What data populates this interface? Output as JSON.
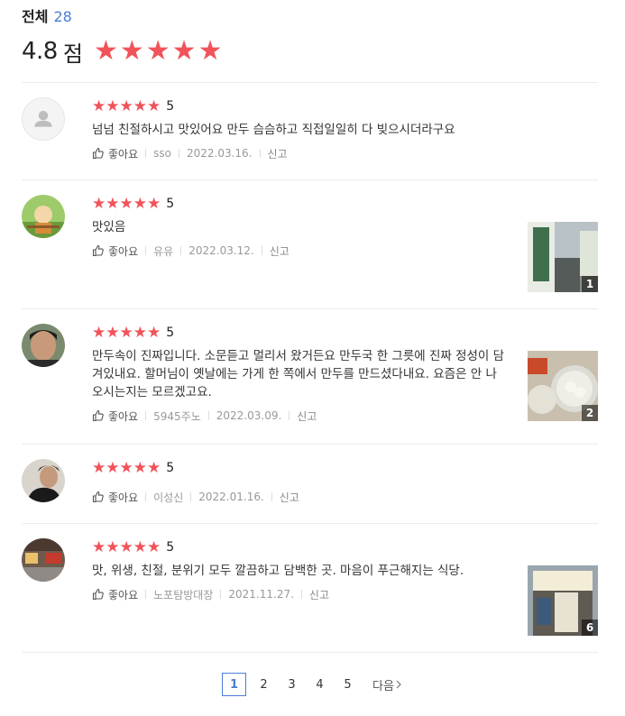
{
  "summary": {
    "total_label": "전체",
    "total_count": "28",
    "score": "4.8",
    "score_unit": "점",
    "star_color": "#f0535a"
  },
  "reviews": [
    {
      "rating": "5",
      "text": "넘넘 친절하시고 맛있어요 만두 슴슴하고 직접일일히 다 빚으시더라구요",
      "like_label": "좋아요",
      "author": "sso",
      "date": "2022.03.16.",
      "report_label": "신고",
      "photo_count": ""
    },
    {
      "rating": "5",
      "text": "맛있음",
      "like_label": "좋아요",
      "author": "유유",
      "date": "2022.03.12.",
      "report_label": "신고",
      "photo_count": "1"
    },
    {
      "rating": "5",
      "text": "만두속이 진짜입니다.  소문듣고 멀리서 왔거든요 만두국 한 그릇에 진짜 정성이 담겨있내요. 할머님이 옛날에는 가게 한 쪽에서 만두를 만드셨다내요. 요즘은 안 나오시는지는 모르겠고요.",
      "like_label": "좋아요",
      "author": "5945주노",
      "date": "2022.03.09.",
      "report_label": "신고",
      "photo_count": "2"
    },
    {
      "rating": "5",
      "text": "",
      "like_label": "좋아요",
      "author": "이성신",
      "date": "2022.01.16.",
      "report_label": "신고",
      "photo_count": ""
    },
    {
      "rating": "5",
      "text": "맛, 위생, 친절, 분위기 모두 깔끔하고 담백한 곳. 마음이 푸근해지는 식당.",
      "like_label": "좋아요",
      "author": "노포탐방대장",
      "date": "2021.11.27.",
      "report_label": "신고",
      "photo_count": "6"
    }
  ],
  "pagination": {
    "pages": [
      "1",
      "2",
      "3",
      "4",
      "5"
    ],
    "active": "1",
    "next_label": "다음"
  }
}
